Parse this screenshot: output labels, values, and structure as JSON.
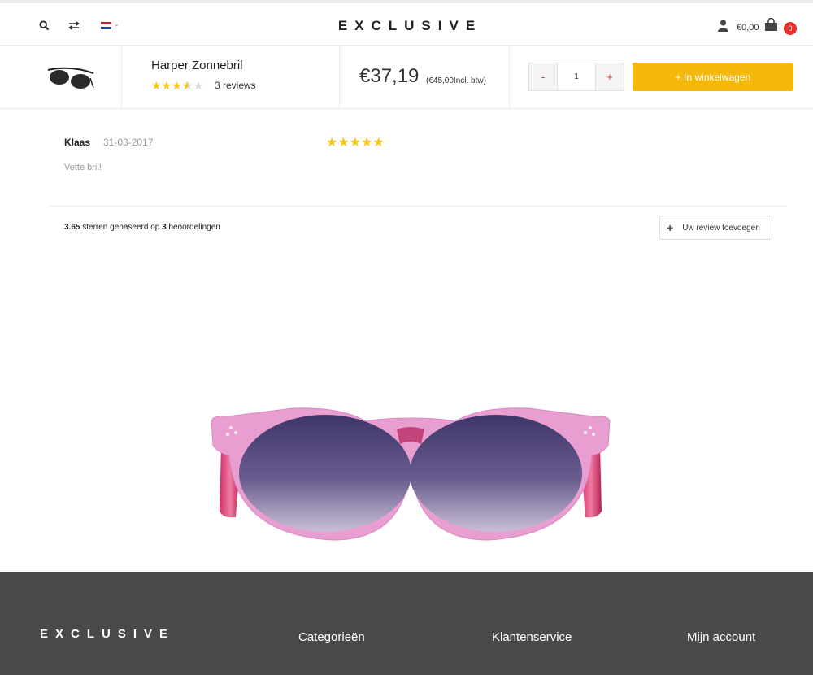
{
  "header": {
    "logo": "EXCLUSIVE",
    "cart_amount": "€0,00",
    "cart_count": "0"
  },
  "product": {
    "name": "Harper Zonnebril",
    "rating": 3.65,
    "reviews_label": "3 reviews",
    "price": "€37,19",
    "price_note": "(€45,00Incl. btw)",
    "quantity": "1",
    "minus": "-",
    "plus": "+",
    "add_to_cart": "+ In winkelwagen"
  },
  "review": {
    "author": "Klaas",
    "date": "31-03-2017",
    "stars": "★★★★★",
    "text": "Vette bril!"
  },
  "summary": {
    "score": "3.65",
    "text_a": " sterren gebaseerd op ",
    "count": "3",
    "text_b": " beoordelingen",
    "add_review_label": "Uw review toevoegen"
  },
  "footer": {
    "logo": "EXCLUSIVE",
    "col1": "Categorieën",
    "col2": "Klantenservice",
    "col3": "Mijn account"
  },
  "colors": {
    "accent": "#f6b80a",
    "badge": "#e8302f",
    "star": "#f5c518",
    "footer_bg": "#494949"
  },
  "icons": [
    "search-icon",
    "compare-icon",
    "flag-nl-icon",
    "user-icon",
    "cart-icon",
    "plus-icon"
  ]
}
